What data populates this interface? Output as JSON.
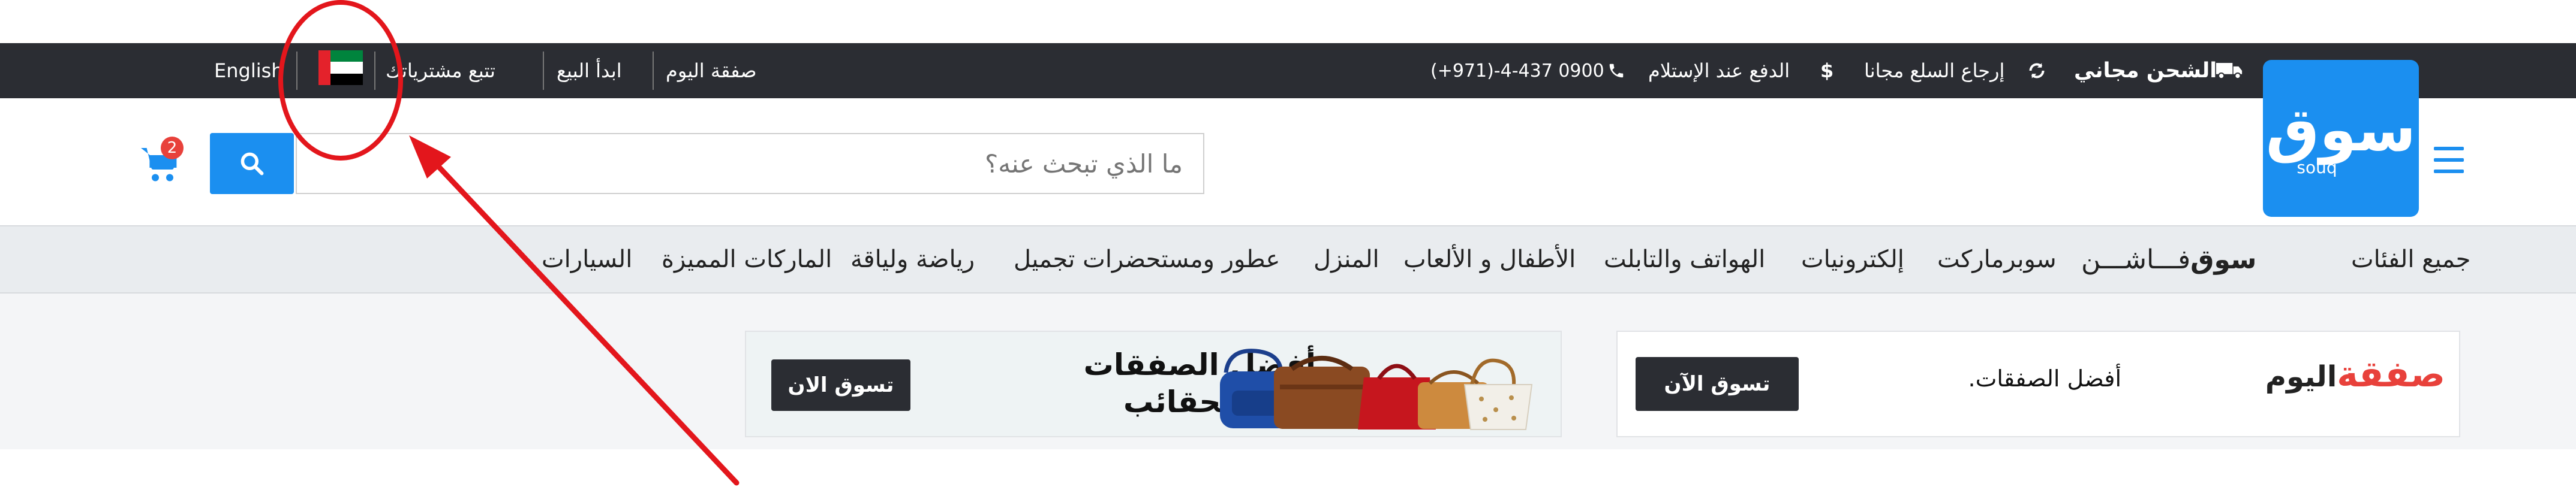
{
  "topbar": {
    "language": "English",
    "track_orders": "تتبع مشترياتك",
    "start_selling": "ابدأ البيع",
    "deal_today": "صفقة اليوم",
    "phone": "(+971)-4-437 0900",
    "cod": "الدفع عند الإستلام",
    "returns": "إرجاع السلع مجانا",
    "free_shipping": "الشحن مجاني"
  },
  "logo": {
    "arabic": "سوق",
    "latin": "souq"
  },
  "search": {
    "placeholder": "ما الذي تبحث عنه؟"
  },
  "cart": {
    "count": "2"
  },
  "nav": {
    "all_categories": "جميع الفئات",
    "fashion_brand": "سوق",
    "fashion_word": "فـــاشـــن",
    "supermarket": "سوبرماركت",
    "electronics": "إلكترونيات",
    "phones": "الهواتف والتابلت",
    "kids": "الأطفال و الألعاب",
    "home": "المنزل",
    "beauty": "عطور ومستحضرات تجميل",
    "sports": "رياضة ولياقة",
    "brands": "الماركات المميزة",
    "cars": "السيارات"
  },
  "banners": {
    "bags_title_line1": "أفضل الصفقات",
    "bags_title_line2": "على الحقائب",
    "bags_cta": "تسوق الان",
    "deal_logo_a": "صفقة",
    "deal_logo_b": "اليوم",
    "deal_text": "أفضل الصفقات.",
    "deal_cta": "تسوق الآن"
  },
  "colors": {
    "brand_blue": "#1b8ff0",
    "dark_bar": "#2b2d33",
    "annotation_red": "#e3161c"
  }
}
